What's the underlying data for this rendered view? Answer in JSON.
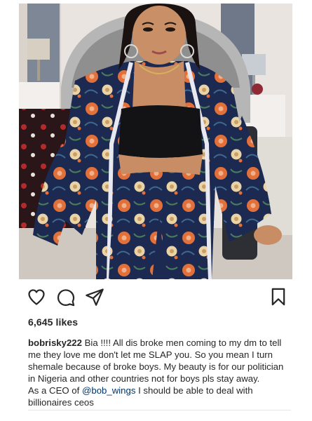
{
  "post": {
    "image_alt": "Person posing in a floral printed two-piece outfit seated on an ornate bed",
    "colors": {
      "outfit_navy": "#1c2a52",
      "outfit_orange": "#e2703a",
      "outfit_cream": "#ead3a6",
      "background": "#e9e4df"
    }
  },
  "actions": {
    "like_icon": "heart-icon",
    "comment_icon": "comment-icon",
    "share_icon": "send-icon",
    "save_icon": "bookmark-icon"
  },
  "likes": {
    "count_text": "6,645 likes"
  },
  "caption": {
    "username": "bobrisky222",
    "text_1": " Bia !!!! All dis broke men coming to my dm to tell me they love me don't let me SLAP you. So you mean I turn shemale because of broke boys. My beauty is for our politician in Nigeria and other countries not for boys pls stay away.",
    "text_2_before": "As a CEO of ",
    "mention": "@bob_wings",
    "text_2_after": " I should be able to deal with billionaires ceos"
  }
}
